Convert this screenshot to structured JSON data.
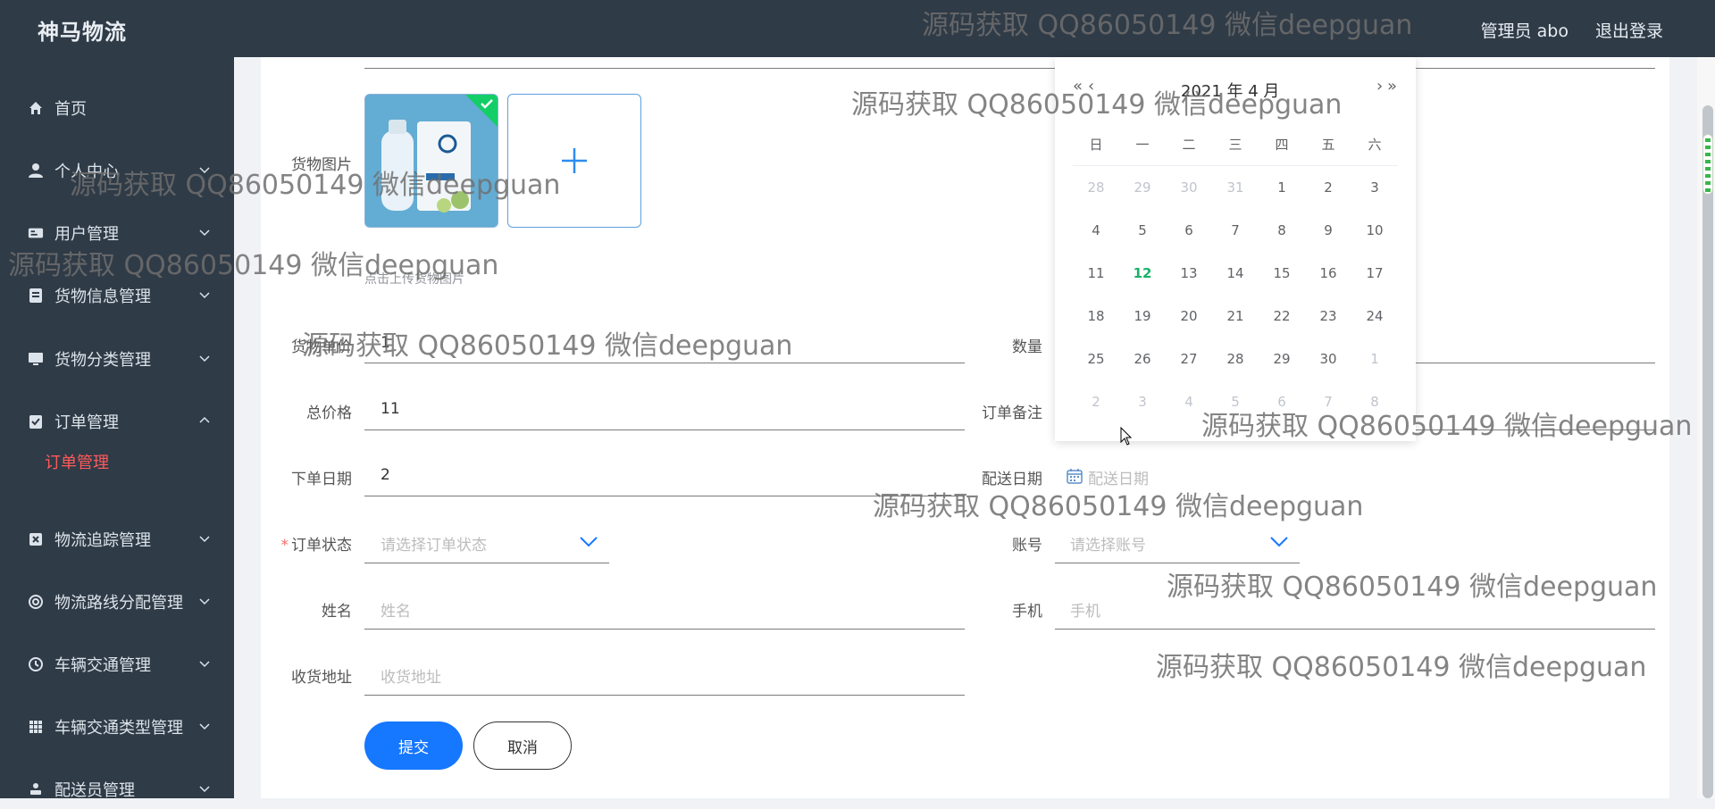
{
  "app": {
    "title": "神马物流"
  },
  "header": {
    "user_label": "管理员 abo",
    "logout_label": "退出登录"
  },
  "sidebar": {
    "items": [
      {
        "label": "首页",
        "icon": "home-icon"
      },
      {
        "label": "个人中心",
        "icon": "user-icon"
      },
      {
        "label": "用户管理",
        "icon": "id-card-icon"
      },
      {
        "label": "货物信息管理",
        "icon": "document-icon"
      },
      {
        "label": "货物分类管理",
        "icon": "monitor-icon"
      },
      {
        "label": "订单管理",
        "icon": "clipboard-check-icon"
      },
      {
        "label": "物流追踪管理",
        "icon": "box-x-icon"
      },
      {
        "label": "物流路线分配管理",
        "icon": "lifebuoy-icon"
      },
      {
        "label": "车辆交通管理",
        "icon": "clock-icon"
      },
      {
        "label": "车辆交通类型管理",
        "icon": "grid-icon"
      },
      {
        "label": "配送员管理",
        "icon": "person-icon"
      }
    ],
    "active_submenu": "订单管理"
  },
  "form": {
    "image_label": "货物图片",
    "upload_hint": "点击上传货物图片",
    "unit_price": {
      "label": "货物单价",
      "value": "1"
    },
    "quantity": {
      "label": "数量",
      "value": ""
    },
    "total_price": {
      "label": "总价格",
      "value": "11"
    },
    "order_note": {
      "label": "订单备注",
      "value": ""
    },
    "order_date": {
      "label": "下单日期",
      "value": "2"
    },
    "delivery_date": {
      "label": "配送日期",
      "placeholder": "配送日期"
    },
    "order_status": {
      "label": "订单状态",
      "placeholder": "请选择订单状态"
    },
    "account": {
      "label": "账号",
      "placeholder": "请选择账号"
    },
    "name": {
      "label": "姓名",
      "placeholder": "姓名"
    },
    "phone": {
      "label": "手机",
      "placeholder": "手机"
    },
    "address": {
      "label": "收货地址",
      "placeholder": "收货地址"
    },
    "submit_label": "提交",
    "cancel_label": "取消"
  },
  "calendar": {
    "title": "2021 年 4 月",
    "prev_year": "«",
    "prev_month": "‹",
    "next_month": "›",
    "next_year": "»",
    "weekdays": [
      "日",
      "一",
      "二",
      "三",
      "四",
      "五",
      "六"
    ],
    "weeks": [
      [
        "28",
        "29",
        "30",
        "31",
        "1",
        "2",
        "3"
      ],
      [
        "4",
        "5",
        "6",
        "7",
        "8",
        "9",
        "10"
      ],
      [
        "11",
        "12",
        "13",
        "14",
        "15",
        "16",
        "17"
      ],
      [
        "18",
        "19",
        "20",
        "21",
        "22",
        "23",
        "24"
      ],
      [
        "25",
        "26",
        "27",
        "28",
        "29",
        "30",
        "1"
      ],
      [
        "2",
        "3",
        "4",
        "5",
        "6",
        "7",
        "8"
      ]
    ],
    "today": "12"
  },
  "watermark": "源码获取 QQ86050149 微信deepguan",
  "colors": {
    "sidebar": "#2f3b47",
    "primary": "#1677ff",
    "active_menu": "#ff5a5a",
    "today": "#17b26a"
  }
}
